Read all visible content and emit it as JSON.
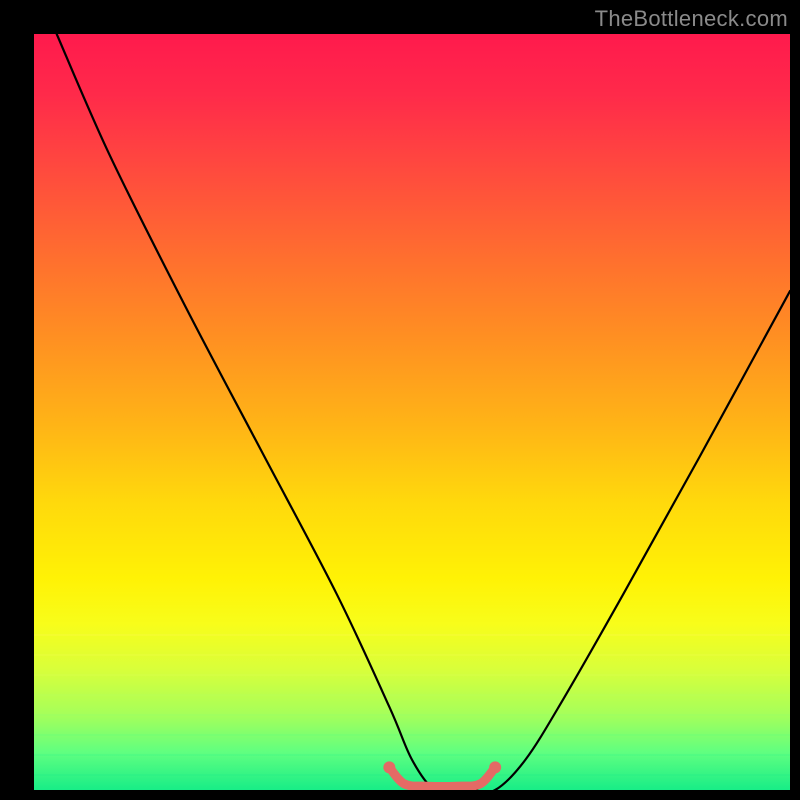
{
  "watermark": "TheBottleneck.com",
  "chart_data": {
    "type": "line",
    "title": "",
    "xlabel": "",
    "ylabel": "",
    "xlim": [
      0,
      100
    ],
    "ylim": [
      0,
      100
    ],
    "grid": false,
    "series": [
      {
        "name": "curve-black",
        "color": "#000000",
        "x": [
          3,
          10,
          20,
          30,
          40,
          47,
          50,
          53,
          56,
          58,
          61,
          65,
          70,
          78,
          88,
          100
        ],
        "values": [
          100,
          84,
          64,
          45,
          26,
          11,
          4,
          0,
          0,
          0,
          0,
          4,
          12,
          26,
          44,
          66
        ]
      },
      {
        "name": "curve-salmon-flat",
        "color": "#e46a65",
        "x": [
          47,
          49,
          52,
          56,
          59,
          61
        ],
        "values": [
          3.0,
          0.8,
          0.5,
          0.5,
          0.8,
          3.0
        ]
      }
    ],
    "annotations": []
  },
  "colors": {
    "background_gradient_top": "#ff1a4d",
    "background_gradient_bottom": "#18ed87",
    "curve_main": "#000000",
    "curve_accent": "#e46a65",
    "frame": "#000000",
    "watermark": "#8a8a8a"
  }
}
